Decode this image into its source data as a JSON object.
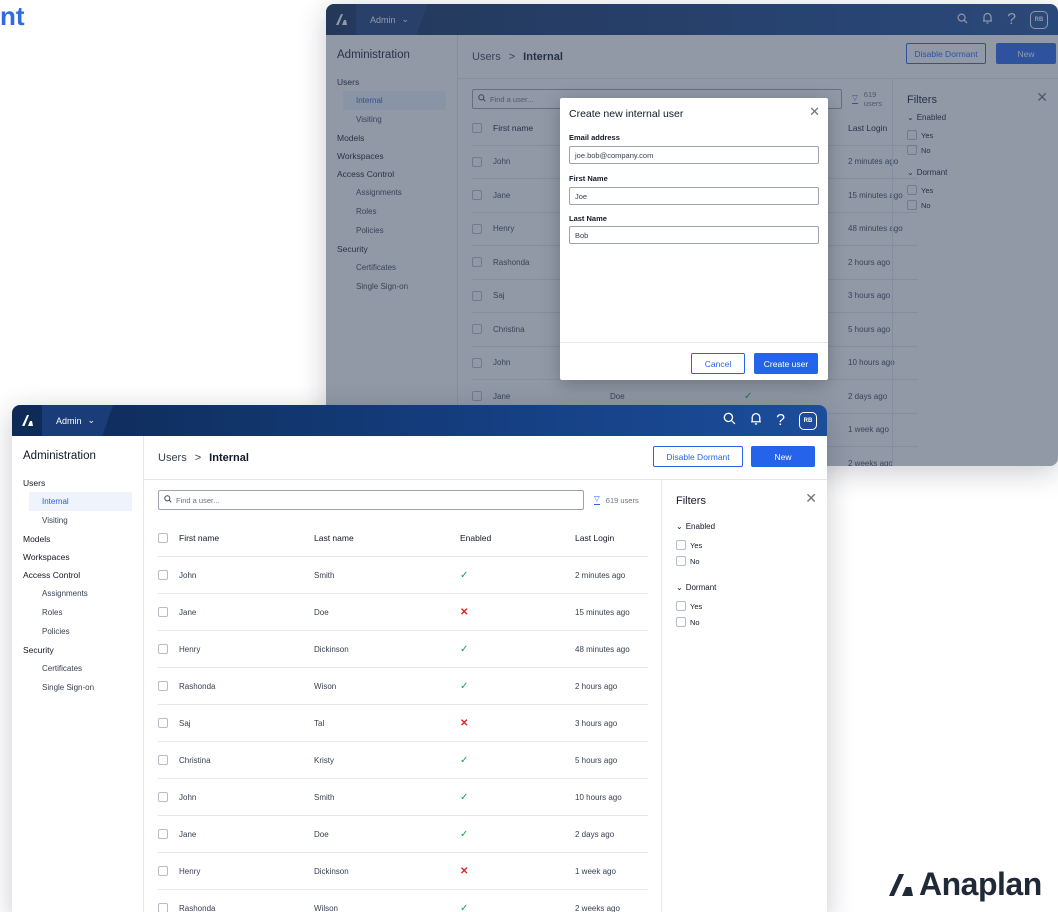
{
  "hero": {
    "title_fragment": "nt"
  },
  "brand": {
    "logo_text": "Anaplan"
  },
  "topbar": {
    "app_menu": "Admin",
    "avatar_initials": "RB",
    "help_glyph": "?"
  },
  "sidebar": {
    "title": "Administration",
    "sections": [
      {
        "label": "Users",
        "items": [
          "Internal",
          "Visiting"
        ]
      },
      {
        "label": "Models",
        "items": []
      },
      {
        "label": "Workspaces",
        "items": []
      },
      {
        "label": "Access Control",
        "items": [
          "Assignments",
          "Roles",
          "Policies"
        ]
      },
      {
        "label": "Security",
        "items": [
          "Certificates",
          "Single Sign-on"
        ]
      }
    ],
    "active_item": "Internal"
  },
  "header": {
    "crumb_parent": "Users",
    "crumb_sep": ">",
    "crumb_current": "Internal",
    "disable_dormant_label": "Disable Dormant",
    "new_label": "New"
  },
  "search": {
    "placeholder": "Find a user...",
    "user_count": "619 users"
  },
  "table": {
    "columns": [
      "First name",
      "Last name",
      "Enabled",
      "Last Login"
    ],
    "back_columns": [
      "First name",
      "Last Login"
    ],
    "rows": [
      {
        "first": "John",
        "last": "Smith",
        "enabled": true,
        "login": "2 minutes ago"
      },
      {
        "first": "Jane",
        "last": "Doe",
        "enabled": false,
        "login": "15 minutes ago"
      },
      {
        "first": "Henry",
        "last": "Dickinson",
        "enabled": true,
        "login": "48 minutes ago"
      },
      {
        "first": "Rashonda",
        "last": "Wison",
        "enabled": true,
        "login": "2 hours ago"
      },
      {
        "first": "Saj",
        "last": "Tal",
        "enabled": false,
        "login": "3 hours ago"
      },
      {
        "first": "Christina",
        "last": "Kristy",
        "enabled": true,
        "login": "5 hours ago"
      },
      {
        "first": "John",
        "last": "Smith",
        "enabled": true,
        "login": "10 hours ago"
      },
      {
        "first": "Jane",
        "last": "Doe",
        "enabled": true,
        "login": "2 days ago"
      },
      {
        "first": "Henry",
        "last": "Dickinson",
        "enabled": false,
        "login": "1 week ago"
      },
      {
        "first": "Rashonda",
        "last": "Wilson",
        "enabled": true,
        "login": "2 weeks ago"
      }
    ]
  },
  "filters": {
    "title": "Filters",
    "groups": [
      {
        "label": "Enabled",
        "options": [
          "Yes",
          "No"
        ]
      },
      {
        "label": "Dormant",
        "options": [
          "Yes",
          "No"
        ]
      }
    ]
  },
  "modal": {
    "title": "Create new internal user",
    "fields": [
      {
        "label": "Email address",
        "value": "joe.bob@company.com"
      },
      {
        "label": "First Name",
        "value": "Joe"
      },
      {
        "label": "Last Name",
        "value": "Bob"
      }
    ],
    "cancel_label": "Cancel",
    "create_label": "Create user"
  },
  "icons": {
    "check": "✓",
    "cross": "✕",
    "close": "✕",
    "chevron": "⌄",
    "crumb_chevron": "›"
  },
  "colors": {
    "accent": "#2563eb",
    "topbar": "#153f82",
    "enabled": "#16a34a",
    "disabled": "#dc2626"
  }
}
